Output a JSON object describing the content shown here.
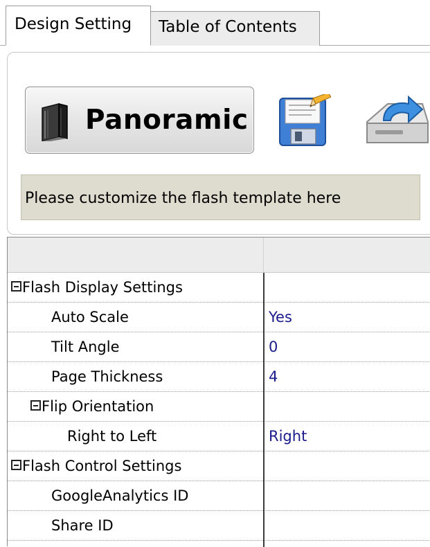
{
  "tabs": [
    {
      "label": "Design Setting",
      "active": true
    },
    {
      "label": "Table of Contents",
      "active": false
    }
  ],
  "toolbar": {
    "template_button_label": "Panoramic",
    "template_icon": "book-icon",
    "save_icon": "save-icon",
    "export_icon": "export-icon",
    "hint": "Please customize the flash template here"
  },
  "grid": {
    "rows": [
      {
        "name": "Flash Display Settings",
        "value": "",
        "type": "group",
        "level": 0
      },
      {
        "name": "Auto Scale",
        "value": "Yes",
        "type": "property",
        "level": 1
      },
      {
        "name": "Tilt Angle",
        "value": "0",
        "type": "property",
        "level": 1
      },
      {
        "name": "Page Thickness",
        "value": "4",
        "type": "property",
        "level": 1
      },
      {
        "name": "Flip Orientation",
        "value": "",
        "type": "group",
        "level": 1
      },
      {
        "name": "Right to Left",
        "value": "Right",
        "type": "property",
        "level": 2
      },
      {
        "name": "Flash Control Settings",
        "value": "",
        "type": "group",
        "level": 0
      },
      {
        "name": "GoogleAnalytics ID",
        "value": "",
        "type": "property",
        "level": 1
      },
      {
        "name": "Share ID",
        "value": "",
        "type": "property",
        "level": 1
      }
    ]
  },
  "colors": {
    "hint_background": "#dedbcf",
    "value_text": "#1a1a8c",
    "grid_header": "#ececec"
  }
}
